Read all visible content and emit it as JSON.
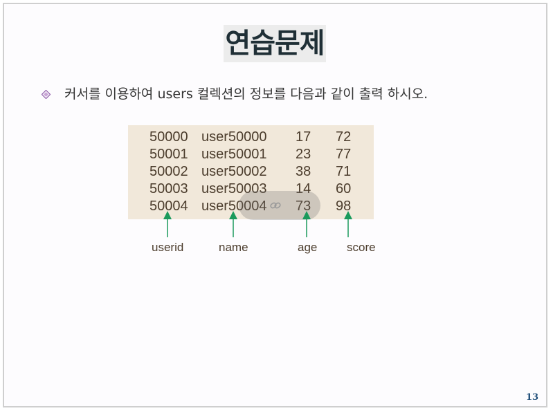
{
  "slide": {
    "title": "연습문제",
    "instruction": "커서를 이용하여 users 컬렉션의 정보를 다음과 같이 출력 하시오.",
    "page_number": "13"
  },
  "colors": {
    "title_bg": "#ececec",
    "box_bg": "#f1e8da",
    "arrow": "#1a9a5c",
    "bullet": "#8e5aa8",
    "page_number": "#1f4e79"
  },
  "table": {
    "rows": [
      {
        "userid": "50000",
        "name": "user50000",
        "age": "17",
        "score": "72"
      },
      {
        "userid": "50001",
        "name": "user50001",
        "age": "23",
        "score": "77"
      },
      {
        "userid": "50002",
        "name": "user50002",
        "age": "38",
        "score": "71"
      },
      {
        "userid": "50003",
        "name": "user50003",
        "age": "14",
        "score": "60"
      },
      {
        "userid": "50004",
        "name": "user50004",
        "age": "73",
        "score": "98"
      }
    ]
  },
  "labels": {
    "userid": "userid",
    "name": "name",
    "age": "age",
    "score": "score"
  },
  "icons": {
    "bullet": "diamond-bullet-icon",
    "overlay": "link-icon"
  }
}
